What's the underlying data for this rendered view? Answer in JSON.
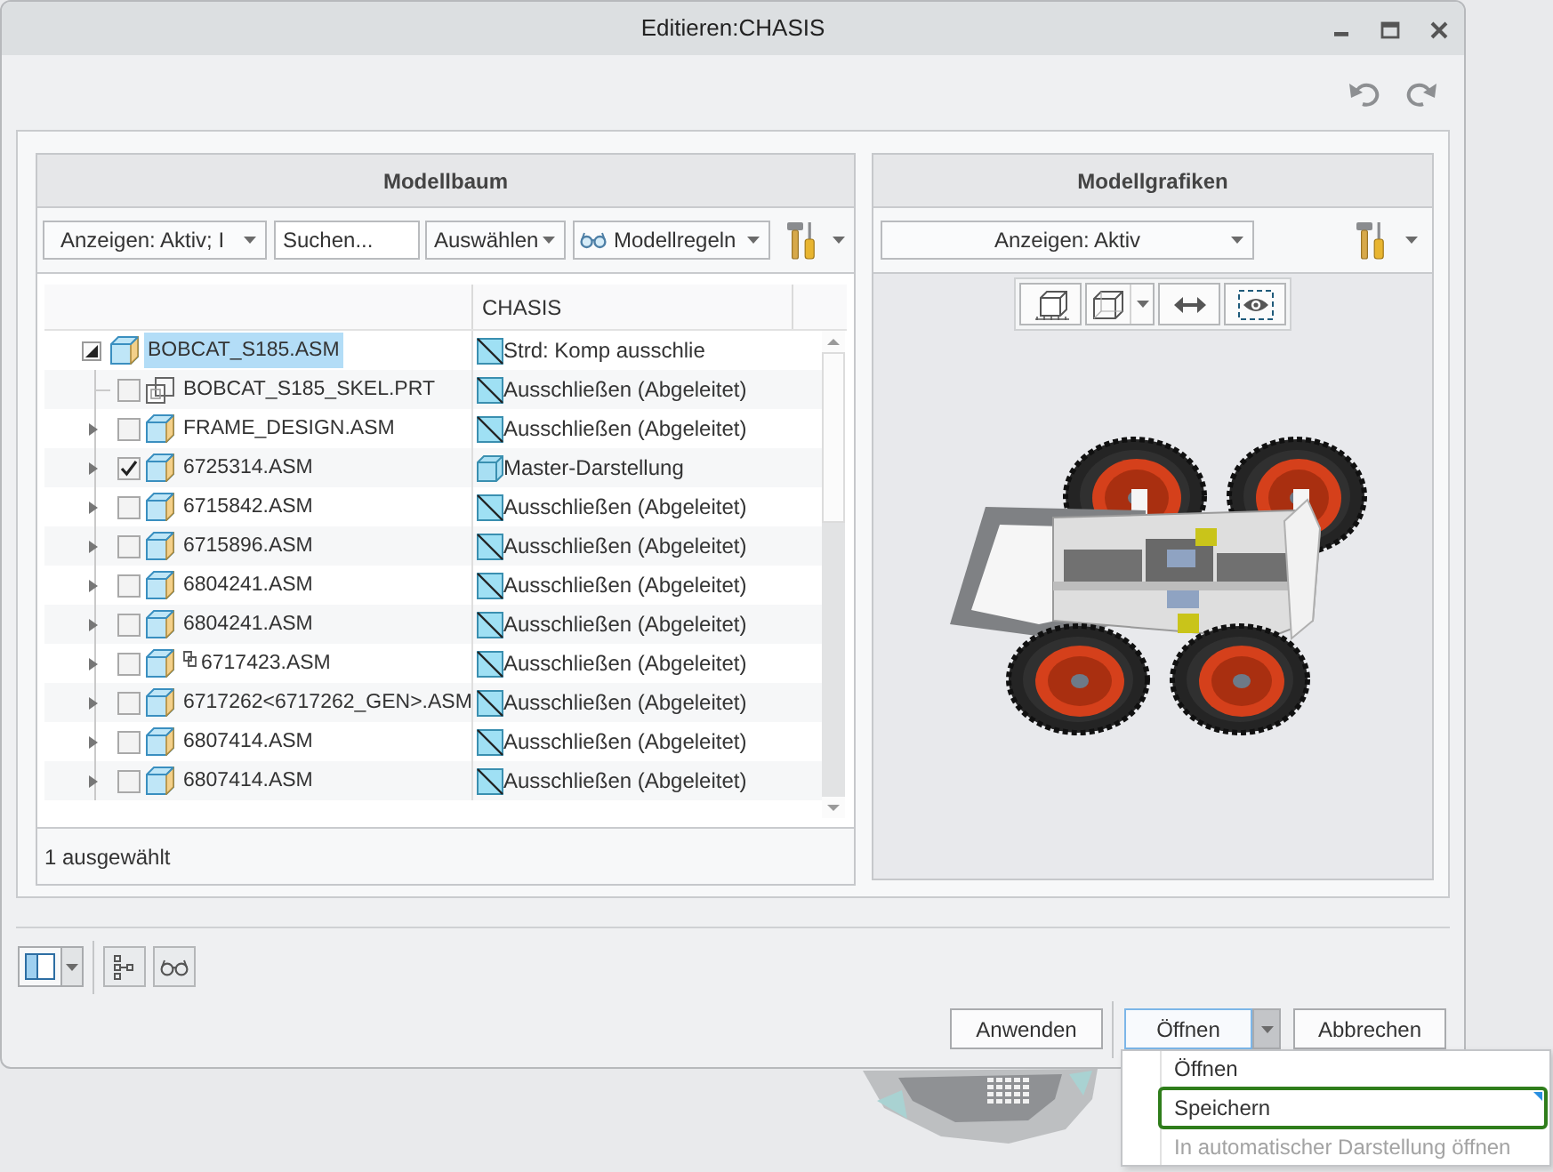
{
  "window": {
    "title": "Editieren:CHASIS"
  },
  "model_tree": {
    "title": "Modellbaum",
    "toolbar": {
      "show_filter": "Anzeigen: Aktiv; I",
      "search": {
        "placeholder": "Suchen..."
      },
      "select_menu": "Auswählen",
      "rules_menu": "Modellregeln"
    },
    "columns": [
      "CHASIS"
    ],
    "rows": [
      {
        "name": "BOBCAT_S185.ASM",
        "kind": "assembly",
        "selected": true,
        "expanded": true,
        "representation": {
          "kind": "excluded",
          "text": "Strd: Komp ausschlie"
        },
        "children": [
          {
            "name": "BOBCAT_S185_SKEL.PRT",
            "kind": "skeleton",
            "checked": false,
            "selected": false,
            "prefix_marker": false,
            "representation": {
              "kind": "excluded",
              "text": "Ausschließen (Abgeleitet)"
            }
          },
          {
            "name": "FRAME_DESIGN.ASM",
            "kind": "assembly",
            "expanded": false,
            "checked": false,
            "selected": false,
            "prefix_marker": false,
            "representation": {
              "kind": "excluded",
              "text": "Ausschließen (Abgeleitet)"
            }
          },
          {
            "name": "6725314.ASM",
            "kind": "assembly",
            "expanded": false,
            "checked": true,
            "selected": false,
            "prefix_marker": false,
            "representation": {
              "kind": "master",
              "text": "Master-Darstellung"
            }
          },
          {
            "name": "6715842.ASM",
            "kind": "assembly",
            "expanded": false,
            "checked": false,
            "selected": false,
            "prefix_marker": false,
            "representation": {
              "kind": "excluded",
              "text": "Ausschließen (Abgeleitet)"
            }
          },
          {
            "name": "6715896.ASM",
            "kind": "assembly",
            "expanded": false,
            "checked": false,
            "selected": false,
            "prefix_marker": false,
            "representation": {
              "kind": "excluded",
              "text": "Ausschließen (Abgeleitet)"
            }
          },
          {
            "name": "6804241.ASM",
            "kind": "assembly",
            "expanded": false,
            "checked": false,
            "selected": false,
            "prefix_marker": false,
            "representation": {
              "kind": "excluded",
              "text": "Ausschließen (Abgeleitet)"
            }
          },
          {
            "name": "6804241.ASM",
            "kind": "assembly",
            "expanded": false,
            "checked": false,
            "selected": false,
            "prefix_marker": false,
            "representation": {
              "kind": "excluded",
              "text": "Ausschließen (Abgeleitet)"
            }
          },
          {
            "name": "6717423.ASM",
            "kind": "assembly",
            "expanded": false,
            "checked": false,
            "selected": false,
            "prefix_marker": true,
            "representation": {
              "kind": "excluded",
              "text": "Ausschließen (Abgeleitet)"
            }
          },
          {
            "name": "6717262<6717262_GEN>.ASM",
            "kind": "assembly",
            "expanded": false,
            "checked": false,
            "selected": false,
            "prefix_marker": false,
            "representation": {
              "kind": "excluded",
              "text": "Ausschließen (Abgeleitet)"
            }
          },
          {
            "name": "6807414.ASM",
            "kind": "assembly",
            "expanded": false,
            "checked": false,
            "selected": false,
            "prefix_marker": false,
            "representation": {
              "kind": "excluded",
              "text": "Ausschließen (Abgeleitet)"
            }
          },
          {
            "name": "6807414.ASM",
            "kind": "assembly",
            "expanded": false,
            "checked": false,
            "selected": false,
            "prefix_marker": false,
            "representation": {
              "kind": "excluded",
              "text": "Ausschließen (Abgeleitet)"
            }
          }
        ]
      }
    ],
    "status": "1 ausgewählt"
  },
  "model_graphics": {
    "title": "Modellgrafiken",
    "show_filter": "Anzeigen: Aktiv",
    "view_tools": [
      {
        "kind": "bounding-box"
      },
      {
        "kind": "cube",
        "menu": true
      },
      {
        "kind": "fit"
      },
      {
        "kind": "eye"
      }
    ]
  },
  "tools": [
    {
      "kind": "layout",
      "menu": true
    },
    {
      "kind": "tree"
    },
    {
      "kind": "glasses"
    }
  ],
  "actions": [
    {
      "label": "Anwenden",
      "kind": "button"
    },
    {
      "label": "Öffnen",
      "kind": "split",
      "expanded": true
    },
    {
      "label": "Abbrechen",
      "kind": "button"
    }
  ],
  "open_menu": {
    "items": [
      {
        "label": "Öffnen",
        "selected": false,
        "disabled": false
      },
      {
        "label": "Speichern",
        "selected": true,
        "disabled": false
      },
      {
        "label": "In automatischer Darstellung öffnen",
        "selected": false,
        "disabled": true
      }
    ]
  }
}
